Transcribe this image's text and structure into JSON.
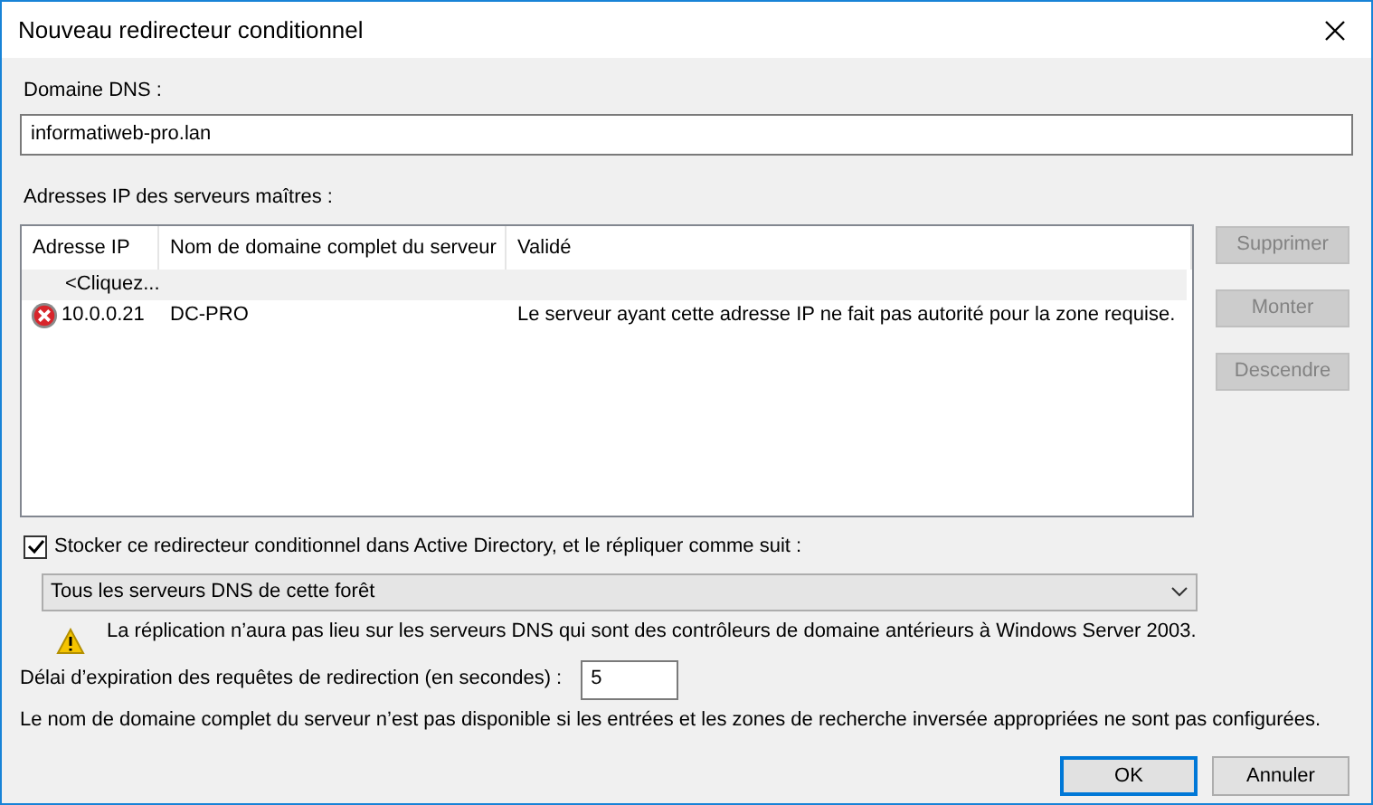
{
  "window": {
    "title": "Nouveau redirecteur conditionnel"
  },
  "dns_domain": {
    "label": "Domaine DNS :",
    "value": "informatiweb-pro.lan"
  },
  "master_servers": {
    "label": "Adresses IP des serveurs maîtres :",
    "columns": [
      "Adresse IP",
      "Nom de domaine complet du serveur",
      "Validé"
    ],
    "rows": [
      {
        "kind": "add",
        "cells": [
          "<Cliquez..."
        ]
      },
      {
        "kind": "entry",
        "invalid": true,
        "cells": [
          "10.0.0.21",
          "DC-PRO",
          "Le serveur ayant cette adresse IP ne fait pas autorité pour la zone requise."
        ]
      }
    ],
    "buttons": [
      {
        "label": "Supprimer",
        "disabled": true
      },
      {
        "label": "Monter",
        "disabled": true
      },
      {
        "label": "Descendre",
        "disabled": true
      }
    ]
  },
  "store_in_ad": {
    "label": "Stocker ce redirecteur conditionnel dans Active Directory, et le répliquer comme suit :",
    "checked": true
  },
  "replication": {
    "value": "Tous les serveurs DNS de cette forêt"
  },
  "warning": "La réplication n’aura pas lieu sur les serveurs DNS qui sont des contrôleurs de domaine antérieurs à Windows Server 2003.",
  "timeout": {
    "label": "Délai d’expiration des requêtes de redirection (en secondes) :",
    "value": "5"
  },
  "note": "Le nom de domaine complet du serveur n’est pas disponible si les entrées et les zones de recherche inversée appropriées ne sont pas configurées.",
  "footer_buttons": [
    {
      "label": "OK",
      "default": true
    },
    {
      "label": "Annuler",
      "default": false
    }
  ]
}
